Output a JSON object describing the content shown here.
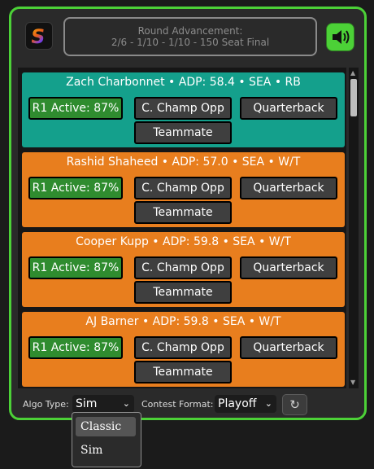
{
  "header": {
    "logo_letter": "S",
    "round_title": "Round Advancement:",
    "round_detail": "2/6 - 1/10 - 1/10 - 150 Seat Final"
  },
  "colors": {
    "accent_green": "#4cd137",
    "card_teal": "#14a08c",
    "card_orange": "#e87e1e",
    "button_green": "#2f8c2f"
  },
  "cards": [
    {
      "title": "Zach Charbonnet • ADP: 58.4 • SEA • RB",
      "r1": "R1 Active: 87%",
      "champ": "C. Champ Opp",
      "qb": "Quarterback",
      "team": "Teammate"
    },
    {
      "title": "Rashid Shaheed • ADP: 57.0 • SEA • W/T",
      "r1": "R1 Active: 87%",
      "champ": "C. Champ Opp",
      "qb": "Quarterback",
      "team": "Teammate"
    },
    {
      "title": "Cooper Kupp • ADP: 59.8 • SEA • W/T",
      "r1": "R1 Active: 87%",
      "champ": "C. Champ Opp",
      "qb": "Quarterback",
      "team": "Teammate"
    },
    {
      "title": "AJ Barner • ADP: 59.8 • SEA • W/T",
      "r1": "R1 Active: 87%",
      "champ": "C. Champ Opp",
      "qb": "Quarterback",
      "team": "Teammate"
    }
  ],
  "footer": {
    "algo_label": "Algo Type:",
    "algo_value": "Sim",
    "contest_label": "Contest Format:",
    "contest_value": "Playoff"
  },
  "dropdown": {
    "options": [
      "Classic",
      "Sim"
    ],
    "highlighted": "Classic"
  }
}
